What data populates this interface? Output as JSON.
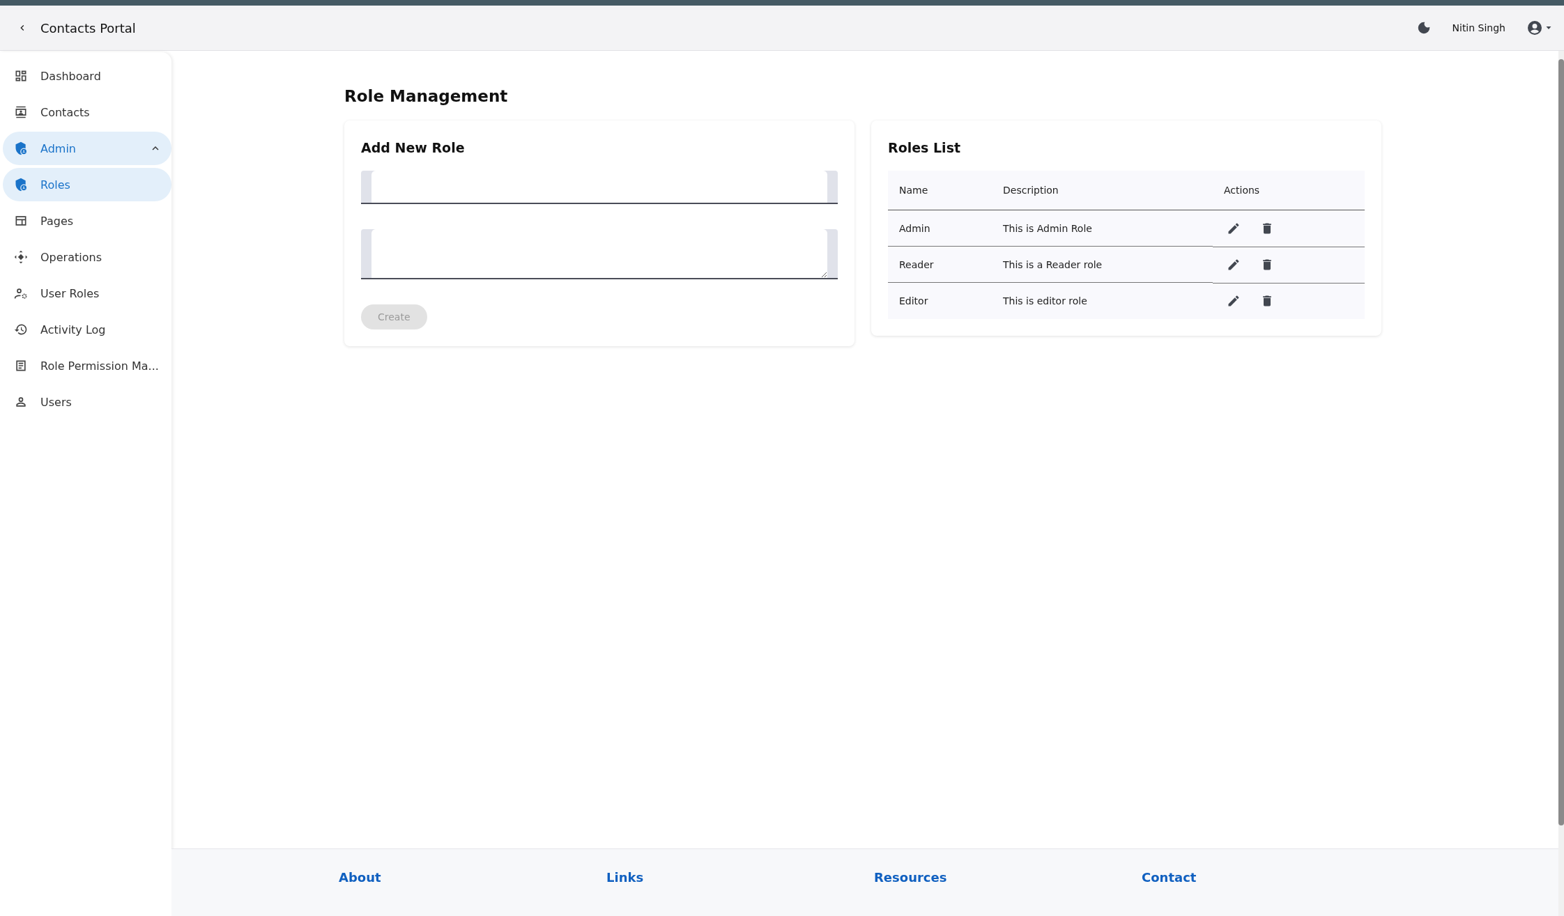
{
  "header": {
    "title": "Contacts Portal",
    "user_name": "Nitin Singh"
  },
  "sidebar": {
    "items": [
      {
        "label": "Dashboard",
        "selected": false
      },
      {
        "label": "Contacts",
        "selected": false
      },
      {
        "label": "Admin",
        "selected": true,
        "expanded": true,
        "children": [
          {
            "label": "Roles",
            "selected": true
          }
        ]
      },
      {
        "label": "Pages",
        "selected": false
      },
      {
        "label": "Operations",
        "selected": false
      },
      {
        "label": "User Roles",
        "selected": false
      },
      {
        "label": "Activity Log",
        "selected": false
      },
      {
        "label": "Role Permission Ma...",
        "selected": false
      },
      {
        "label": "Users",
        "selected": false
      }
    ]
  },
  "page": {
    "title": "Role Management"
  },
  "add_role_card": {
    "title": "Add New Role",
    "fields": [
      {
        "kind": "input"
      },
      {
        "kind": "textarea"
      }
    ],
    "button": {
      "label": "Create",
      "disabled": true
    }
  },
  "roles_card": {
    "title": "Roles List",
    "table": {
      "columns": [
        "Name",
        "Description",
        "Actions"
      ],
      "rows": [
        {
          "name": "Admin",
          "description": "This is Admin Role"
        },
        {
          "name": "Reader",
          "description": "This is a Reader role"
        },
        {
          "name": "Editor",
          "description": "This is editor role"
        }
      ]
    }
  },
  "footer": {
    "headings": [
      "About",
      "Links",
      "Resources",
      "Contact"
    ]
  }
}
